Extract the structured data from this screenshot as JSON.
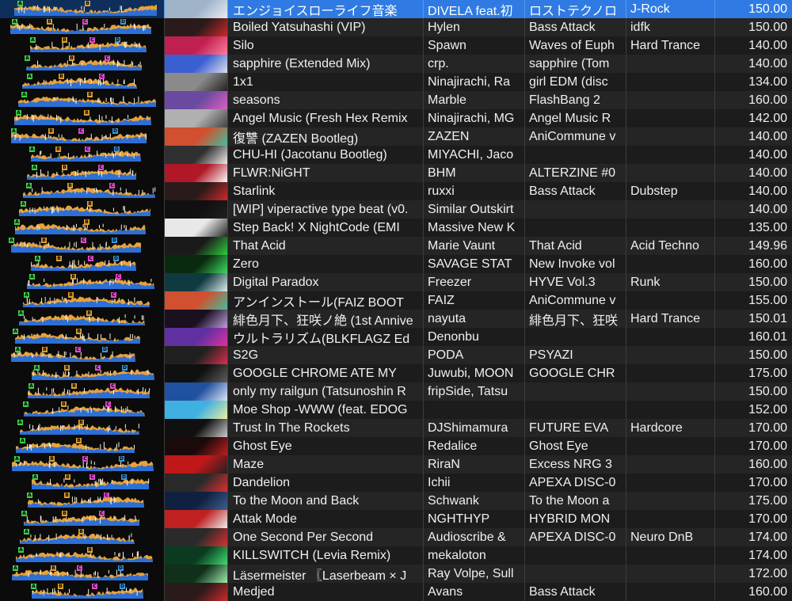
{
  "tracks": [
    {
      "title": "エンジョイスローライフ音楽",
      "artist": "DIVELA feat.初",
      "album": "ロストテクノロ",
      "genre": "J-Rock",
      "bpm": "150.00",
      "selected": true,
      "art_color": "#9fb4c8",
      "art_accent": "#e8eef5"
    },
    {
      "title": "Boiled Yatsuhashi (VIP)",
      "artist": "Hylen",
      "album": "Bass Attack",
      "genre": "idfk",
      "bpm": "150.00",
      "art_color": "#2a1a1a",
      "art_accent": "#d02a2a"
    },
    {
      "title": "Silo",
      "artist": "Spawn",
      "album": "Waves of Euph",
      "genre": "Hard Trance",
      "bpm": "140.00",
      "art_color": "#c02050",
      "art_accent": "#ff7fa0"
    },
    {
      "title": "sapphire (Extended Mix)",
      "artist": "crp.",
      "album": "sapphire (Tom",
      "genre": "",
      "bpm": "140.00",
      "art_color": "#3a5fd0",
      "art_accent": "#e0e0f0"
    },
    {
      "title": "1x1",
      "artist": "Ninajirachi, Ra",
      "album": "girl EDM (disc",
      "genre": "",
      "bpm": "134.00",
      "art_color": "#8a8a8a",
      "art_accent": "#202020"
    },
    {
      "title": "seasons",
      "artist": "Marble",
      "album": "FlashBang 2",
      "genre": "",
      "bpm": "160.00",
      "art_color": "#6a4aa0",
      "art_accent": "#e060c0"
    },
    {
      "title": "Angel Music (Fresh Hex Remix",
      "artist": "Ninajirachi, MG",
      "album": "Angel Music R",
      "genre": "",
      "bpm": "142.00",
      "art_color": "#b0b0b0",
      "art_accent": "#404040"
    },
    {
      "title": "復讐 (ZAZEN Bootleg)",
      "artist": "ZAZEN",
      "album": "AniCommune v",
      "genre": "",
      "bpm": "140.00",
      "art_color": "#d05030",
      "art_accent": "#40c0a0"
    },
    {
      "title": "CHU-HI (Jacotanu Bootleg)",
      "artist": "MIYACHI, Jaco",
      "album": "",
      "genre": "",
      "bpm": "140.00",
      "art_color": "#303030",
      "art_accent": "#f0f0f0"
    },
    {
      "title": "FLWR:NiGHT",
      "artist": "BHM",
      "album": "ALTERZINE #0",
      "genre": "",
      "bpm": "140.00",
      "art_color": "#b01828",
      "art_accent": "#ffffff"
    },
    {
      "title": "Starlink",
      "artist": "ruxxi",
      "album": "Bass Attack",
      "genre": "Dubstep",
      "bpm": "140.00",
      "art_color": "#2a1a1a",
      "art_accent": "#d02a2a"
    },
    {
      "title": "[WIP] viperactive type beat (v0.",
      "artist": "Similar Outskirt",
      "album": "",
      "genre": "",
      "bpm": "140.00",
      "art_color": "#101010",
      "art_accent": "#202020"
    },
    {
      "title": "Step Back! X NightCode (EMI",
      "artist": "Massive New K",
      "album": "",
      "genre": "",
      "bpm": "135.00",
      "art_color": "#e8e8e8",
      "art_accent": "#202020"
    },
    {
      "title": "That Acid",
      "artist": "Marie Vaunt",
      "album": "That Acid",
      "genre": "Acid Techno",
      "bpm": "149.96",
      "art_color": "#1a1a1a",
      "art_accent": "#30d040"
    },
    {
      "title": "Zero",
      "artist": "SAVAGE STAT",
      "album": "New Invoke vol",
      "genre": "",
      "bpm": "160.00",
      "art_color": "#0a2a10",
      "art_accent": "#40e060"
    },
    {
      "title": "Digital Paradox",
      "artist": "Freezer",
      "album": "HYVE Vol.3",
      "genre": "Runk",
      "bpm": "150.00",
      "art_color": "#0e3a40",
      "art_accent": "#e0f0f0"
    },
    {
      "title": "アンインストール(FAIZ BOOT",
      "artist": "FAIZ",
      "album": "AniCommune v",
      "genre": "",
      "bpm": "155.00",
      "art_color": "#d05030",
      "art_accent": "#40c0a0"
    },
    {
      "title": "緋色月下、狂咲ノ絶 (1st Annive",
      "artist": "nayuta",
      "album": "緋色月下、狂咲",
      "genre": "Hard Trance",
      "bpm": "150.01",
      "art_color": "#1a1020",
      "art_accent": "#c0a0e0"
    },
    {
      "title": "ウルトラリズム(BLKFLAGZ Ed",
      "artist": "Denonbu",
      "album": "",
      "genre": "",
      "bpm": "160.01",
      "art_color": "#6030a0",
      "art_accent": "#e030a0"
    },
    {
      "title": "S2G",
      "artist": "PODA",
      "album": "PSYAZI",
      "genre": "",
      "bpm": "150.00",
      "art_color": "#202020",
      "art_accent": "#e03050"
    },
    {
      "title": "GOOGLE CHROME ATE MY",
      "artist": "Juwubi, MOON",
      "album": "GOOGLE CHR",
      "genre": "",
      "bpm": "175.00",
      "art_color": "#101010",
      "art_accent": "#606060"
    },
    {
      "title": "only my railgun (Tatsunoshin R",
      "artist": "fripSide, Tatsu",
      "album": "",
      "genre": "",
      "bpm": "150.00",
      "art_color": "#2050a0",
      "art_accent": "#e0e8f8"
    },
    {
      "title": "Moe Shop -WWW (feat. EDOG",
      "artist": "",
      "album": "",
      "genre": "",
      "bpm": "152.00",
      "art_color": "#40b0e0",
      "art_accent": "#f0f0a0"
    },
    {
      "title": "Trust In The Rockets",
      "artist": "DJShimamura",
      "album": "FUTURE EVA",
      "genre": "Hardcore",
      "bpm": "170.00",
      "art_color": "#101010",
      "art_accent": "#d0d0d0"
    },
    {
      "title": "Ghost Eye",
      "artist": "Redalice",
      "album": "Ghost Eye",
      "genre": "",
      "bpm": "170.00",
      "art_color": "#1a0a0a",
      "art_accent": "#c02020"
    },
    {
      "title": "Maze",
      "artist": "RiraN",
      "album": "Excess NRG 3",
      "genre": "",
      "bpm": "160.00",
      "art_color": "#c01818",
      "art_accent": "#202020"
    },
    {
      "title": "Dandelion",
      "artist": "Ichii",
      "album": "APEXA DISC-0",
      "genre": "",
      "bpm": "170.00",
      "art_color": "#2a2a2a",
      "art_accent": "#e03030"
    },
    {
      "title": "To the Moon and Back",
      "artist": "Schwank",
      "album": "To the Moon a",
      "genre": "",
      "bpm": "175.00",
      "art_color": "#102040",
      "art_accent": "#406090"
    },
    {
      "title": "Attak Mode",
      "artist": "NGHTHYP",
      "album": "HYBRID MON",
      "genre": "",
      "bpm": "170.00",
      "art_color": "#c02020",
      "art_accent": "#f0f0f0"
    },
    {
      "title": "One Second Per Second",
      "artist": "Audioscribe &",
      "album": "APEXA DISC-0",
      "genre": "Neuro DnB",
      "bpm": "174.00",
      "art_color": "#2a2a2a",
      "art_accent": "#e03030"
    },
    {
      "title": "KILLSWITCH (Levia Remix)",
      "artist": "mekaloton",
      "album": "",
      "genre": "",
      "bpm": "174.00",
      "art_color": "#0a3a20",
      "art_accent": "#40e070"
    },
    {
      "title": "Läsermeister 〖Laserbeam × J",
      "artist": "Ray Volpe, Sull",
      "album": "",
      "genre": "",
      "bpm": "172.00",
      "art_color": "#10301a",
      "art_accent": "#a0f0b0"
    },
    {
      "title": "Medjed",
      "artist": "Avans",
      "album": "Bass Attack",
      "genre": "",
      "bpm": "160.00",
      "art_color": "#2a1a1a",
      "art_accent": "#d02a2a"
    }
  ]
}
